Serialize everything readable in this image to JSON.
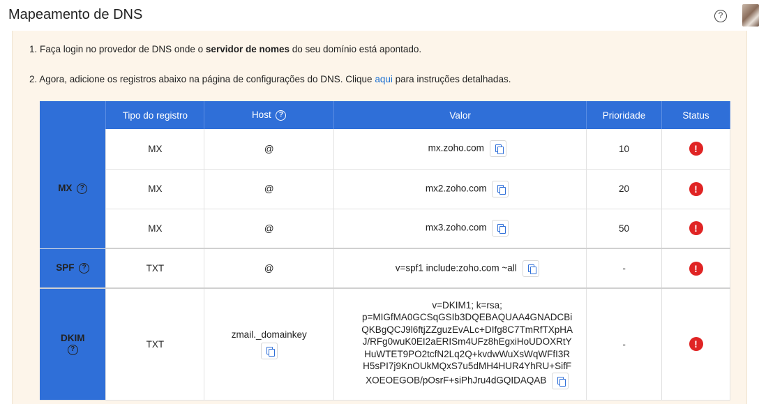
{
  "header": {
    "title": "Mapeamento de DNS",
    "help_icon": "?"
  },
  "instructions": {
    "step1_prefix": "1. Faça login no provedor de DNS onde o ",
    "step1_bold": "servidor de nomes",
    "step1_suffix": " do seu domínio está apontado.",
    "step2_prefix": "2. Agora, adicione os registros abaixo na página de configurações do DNS. Clique ",
    "step2_link": "aqui",
    "step2_suffix": " para instruções detalhadas."
  },
  "table": {
    "headers": {
      "group": "",
      "type": "Tipo do registro",
      "host": "Host",
      "value": "Valor",
      "priority": "Prioridade",
      "status": "Status"
    },
    "groups": {
      "mx": "MX",
      "spf": "SPF",
      "dkim": "DKIM"
    },
    "rows": [
      {
        "type": "MX",
        "host": "@",
        "value": "mx.zoho.com",
        "priority": "10",
        "status": "!"
      },
      {
        "type": "MX",
        "host": "@",
        "value": "mx2.zoho.com",
        "priority": "20",
        "status": "!"
      },
      {
        "type": "MX",
        "host": "@",
        "value": "mx3.zoho.com",
        "priority": "50",
        "status": "!"
      },
      {
        "type": "TXT",
        "host": "@",
        "value": "v=spf1 include:zoho.com ~all",
        "priority": "-",
        "status": "!"
      },
      {
        "type": "TXT",
        "host": "zmail._domainkey",
        "value_lines": [
          "v=DKIM1; k=rsa;",
          "p=MIGfMA0GCSqGSIb3DQEBAQUAA4GNADCBi",
          "QKBgQCJ9l6ftjZZguzEvALc+DIfg8C7TmRfTXpHA",
          "J/RFg0wuK0EI2aERISm4UFz8hEgxiHoUDOXRtY",
          "HuWTET9PO2tcfN2Lq2Q+kvdwWuXsWqWFfI3R",
          "H5sPI7j9KnOUkMQxS7u5dMH4HUR4YhRU+SifF",
          "XOEOEGOB/pOsrF+siPhJru4dGQIDAQAB"
        ],
        "priority": "-",
        "status": "!"
      }
    ]
  },
  "colors": {
    "header_blue": "#2f6fd8",
    "panel_bg": "#fdf5ea",
    "error_red": "#e02424",
    "link_blue": "#1b6fd1"
  }
}
